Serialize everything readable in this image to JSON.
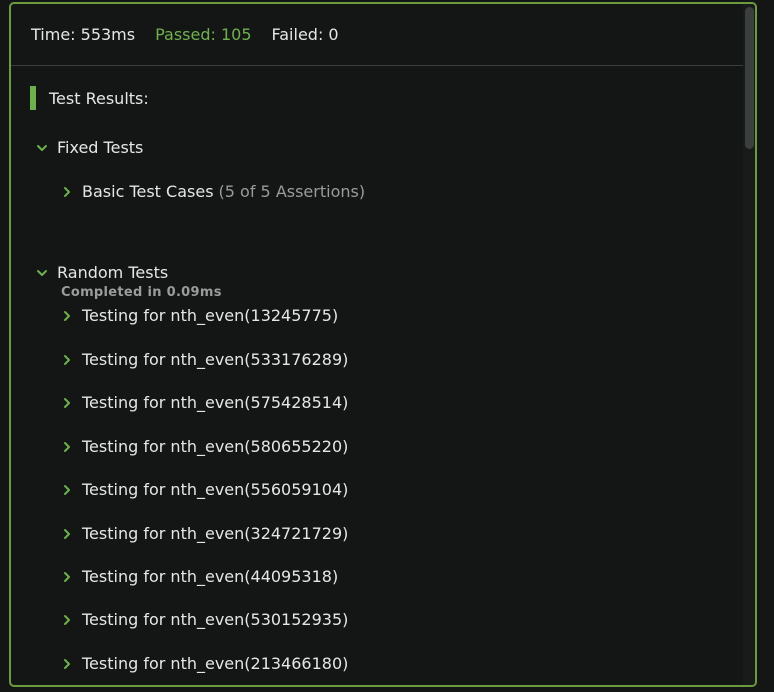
{
  "summary": {
    "time": "Time: 553ms",
    "passed": "Passed: 105",
    "failed": "Failed: 0"
  },
  "results": {
    "header": "Test Results:"
  },
  "groups": {
    "fixed": {
      "label": "Fixed Tests",
      "case": {
        "label": "Basic Test Cases",
        "assertions": "(5 of 5 Assertions)"
      },
      "completed": "Completed in 0.09ms"
    },
    "random": {
      "label": "Random Tests",
      "tests": [
        "Testing for nth_even(13245775)",
        "Testing for nth_even(533176289)",
        "Testing for nth_even(575428514)",
        "Testing for nth_even(580655220)",
        "Testing for nth_even(556059104)",
        "Testing for nth_even(324721729)",
        "Testing for nth_even(44095318)",
        "Testing for nth_even(530152935)",
        "Testing for nth_even(213466180)"
      ]
    }
  },
  "colors": {
    "accent": "#6fb04e",
    "border": "#6e9a3f",
    "background": "#141616"
  }
}
